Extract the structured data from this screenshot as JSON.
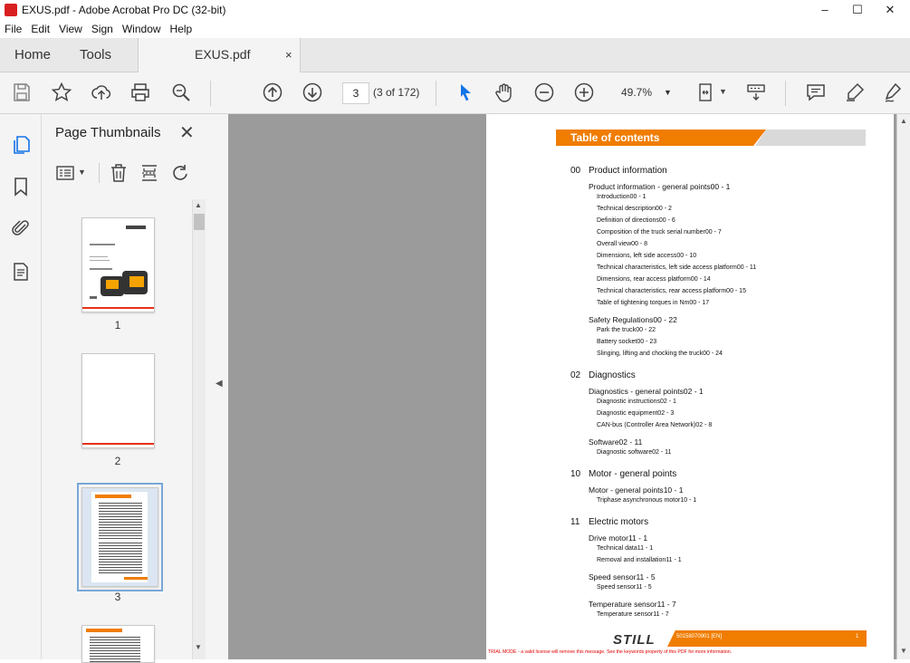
{
  "window": {
    "title": "EXUS.pdf - Adobe Acrobat Pro DC (32-bit)",
    "minimize": "–",
    "maximize": "☐",
    "close": "✕"
  },
  "menu": [
    "File",
    "Edit",
    "View",
    "Sign",
    "Window",
    "Help"
  ],
  "tabs": {
    "home": "Home",
    "tools": "Tools",
    "document": "EXUS.pdf",
    "close": "×"
  },
  "toolbar": {
    "current_page": "3",
    "page_count": "(3 of 172)",
    "zoom": "49.7%"
  },
  "panel": {
    "title": "Page Thumbnails",
    "close": "✕"
  },
  "thumbnails": [
    {
      "label": "1"
    },
    {
      "label": "2"
    },
    {
      "label": "3",
      "selected": true
    }
  ],
  "toc": {
    "header": "Table of contents",
    "chapters": [
      {
        "num": "00",
        "title": "Product information",
        "sections": [
          {
            "title": "Product information - general points",
            "page": "00 - 1",
            "items": [
              {
                "title": "Introduction",
                "page": "00 - 1"
              },
              {
                "title": "Technical description",
                "page": "00 - 2"
              },
              {
                "title": "Definition of directions",
                "page": "00 - 6"
              },
              {
                "title": "Composition of the truck serial number",
                "page": "00 - 7"
              },
              {
                "title": "Overall view",
                "page": "00 - 8"
              },
              {
                "title": "Dimensions, left side access",
                "page": "00 - 10"
              },
              {
                "title": "Technical characteristics, left side access platform",
                "page": "00 - 11"
              },
              {
                "title": "Dimensions, rear access platform",
                "page": "00 - 14"
              },
              {
                "title": "Technical characteristics, rear access platform",
                "page": "00 - 15"
              },
              {
                "title": "Table of tightening torques in Nm",
                "page": "00 - 17"
              }
            ]
          },
          {
            "title": "Safety Regulations",
            "page": "00 - 22",
            "items": [
              {
                "title": "Park the truck",
                "page": "00 - 22"
              },
              {
                "title": "Battery socket",
                "page": "00 - 23"
              },
              {
                "title": "Slinging, lifting and chocking the truck",
                "page": "00 - 24"
              }
            ]
          }
        ]
      },
      {
        "num": "02",
        "title": "Diagnostics",
        "sections": [
          {
            "title": "Diagnostics - general points",
            "page": "02 - 1",
            "items": [
              {
                "title": "Diagnostic instructions",
                "page": "02 - 1"
              },
              {
                "title": "Diagnostic equipment",
                "page": "02 - 3"
              },
              {
                "title": "CAN-bus (Controller Area Network)",
                "page": "02 - 8"
              }
            ]
          },
          {
            "title": "Software",
            "page": "02 - 11",
            "items": [
              {
                "title": "Diagnostic software",
                "page": "02 - 11"
              }
            ]
          }
        ]
      },
      {
        "num": "10",
        "title": "Motor - general points",
        "sections": [
          {
            "title": "Motor - general points",
            "page": "10 - 1",
            "items": [
              {
                "title": "Triphase asynchronous motor",
                "page": "10 - 1"
              }
            ]
          }
        ]
      },
      {
        "num": "11",
        "title": "Electric motors",
        "sections": [
          {
            "title": "Drive motor",
            "page": "11 - 1",
            "items": [
              {
                "title": "Technical data",
                "page": "11 - 1"
              },
              {
                "title": "Removal and installation",
                "page": "11 - 1"
              }
            ]
          },
          {
            "title": "Speed sensor",
            "page": "11 - 5",
            "items": [
              {
                "title": "Speed sensor",
                "page": "11 - 5"
              }
            ]
          },
          {
            "title": "Temperature sensor",
            "page": "11 - 7",
            "items": [
              {
                "title": "Temperature sensor",
                "page": "11 - 7"
              }
            ]
          }
        ]
      }
    ],
    "footer_code": "50158070901 [EN]",
    "footer_page": "1",
    "logo": "STILL",
    "trial_notice": "TRIAL MODE - a valid license will remove this message. See the keywords property of this PDF for more information."
  },
  "colors": {
    "accent": "#f07d00",
    "select": "#1473e6"
  }
}
